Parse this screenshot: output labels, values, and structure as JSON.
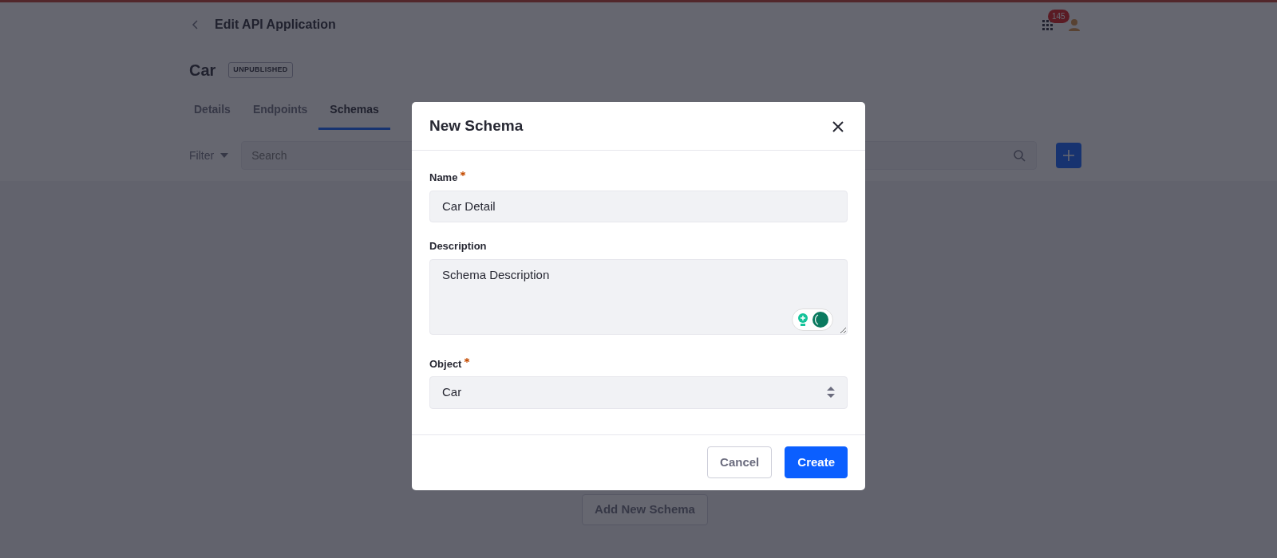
{
  "header": {
    "title": "Edit API Application",
    "notification_count": "145"
  },
  "application": {
    "name": "Car",
    "status": "UNPUBLISHED"
  },
  "tabs": [
    {
      "label": "Details",
      "selected": false
    },
    {
      "label": "Endpoints",
      "selected": false
    },
    {
      "label": "Schemas",
      "selected": true
    }
  ],
  "toolbar": {
    "filter": "Filter",
    "search": {
      "placeholder": "Search"
    }
  },
  "empty_state": {
    "button": "Add New Schema"
  },
  "modal": {
    "title": "New Schema",
    "fields": [
      {
        "kind": "text",
        "label": "Name",
        "required": true,
        "value": "Car Detail"
      },
      {
        "kind": "textarea",
        "label": "Description",
        "required": false,
        "value": "Schema Description"
      },
      {
        "kind": "select",
        "label": "Object",
        "required": true,
        "value": "Car"
      }
    ],
    "buttons": [
      {
        "label": "Cancel",
        "primary": false
      },
      {
        "label": "Create",
        "primary": true
      }
    ]
  }
}
